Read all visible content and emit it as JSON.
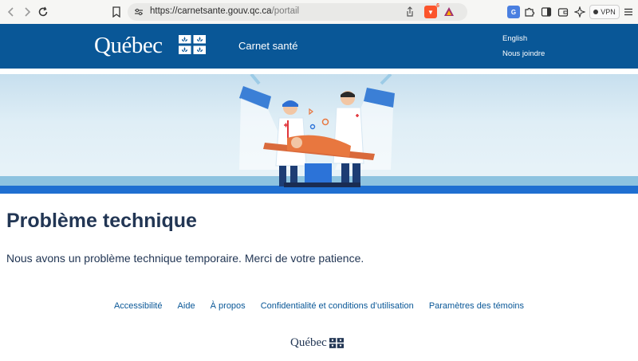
{
  "browser": {
    "url_host": "https://carnetsante.gouv.qc.ca",
    "url_path": "/portail",
    "extension_badge": "6",
    "vpn_label": "VPN"
  },
  "header": {
    "logo_text": "Québec",
    "app_title": "Carnet santé",
    "lang_link": "English",
    "contact_link": "Nous joindre",
    "brand_color": "#095797"
  },
  "main": {
    "title": "Problème technique",
    "message": "Nous avons un problème technique temporaire. Merci de votre patience."
  },
  "footer": {
    "links": [
      "Accessibilité",
      "Aide",
      "À propos",
      "Confidentialité et conditions d’utilisation",
      "Paramètres des témoins"
    ],
    "logo_text": "Québec"
  }
}
